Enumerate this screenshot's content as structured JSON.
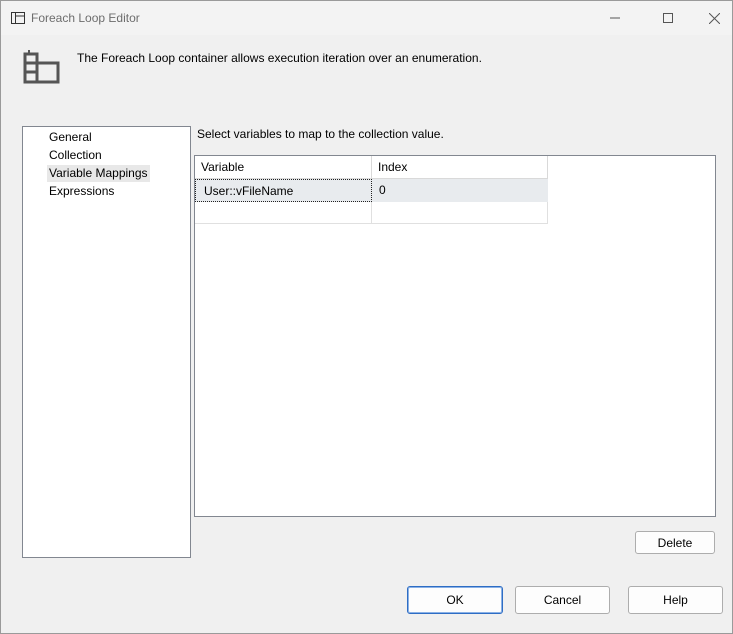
{
  "window": {
    "title": "Foreach Loop Editor"
  },
  "header": {
    "description": "The Foreach Loop container allows execution iteration over an enumeration."
  },
  "nav": {
    "items": [
      {
        "label": "General"
      },
      {
        "label": "Collection"
      },
      {
        "label": "Variable Mappings",
        "selected": true
      },
      {
        "label": "Expressions"
      }
    ]
  },
  "main": {
    "instruction": "Select variables to map to the collection value.",
    "grid": {
      "columns": [
        "Variable",
        "Index"
      ],
      "rows": [
        {
          "variable": "User::vFileName",
          "index": "0"
        }
      ]
    }
  },
  "buttons": {
    "delete": "Delete",
    "ok": "OK",
    "cancel": "Cancel",
    "help": "Help"
  },
  "icons": {
    "title": "foreach-loop-icon",
    "header": "foreach-container-icon",
    "minimize": "minimize-icon",
    "maximize": "maximize-icon",
    "close": "close-icon"
  }
}
